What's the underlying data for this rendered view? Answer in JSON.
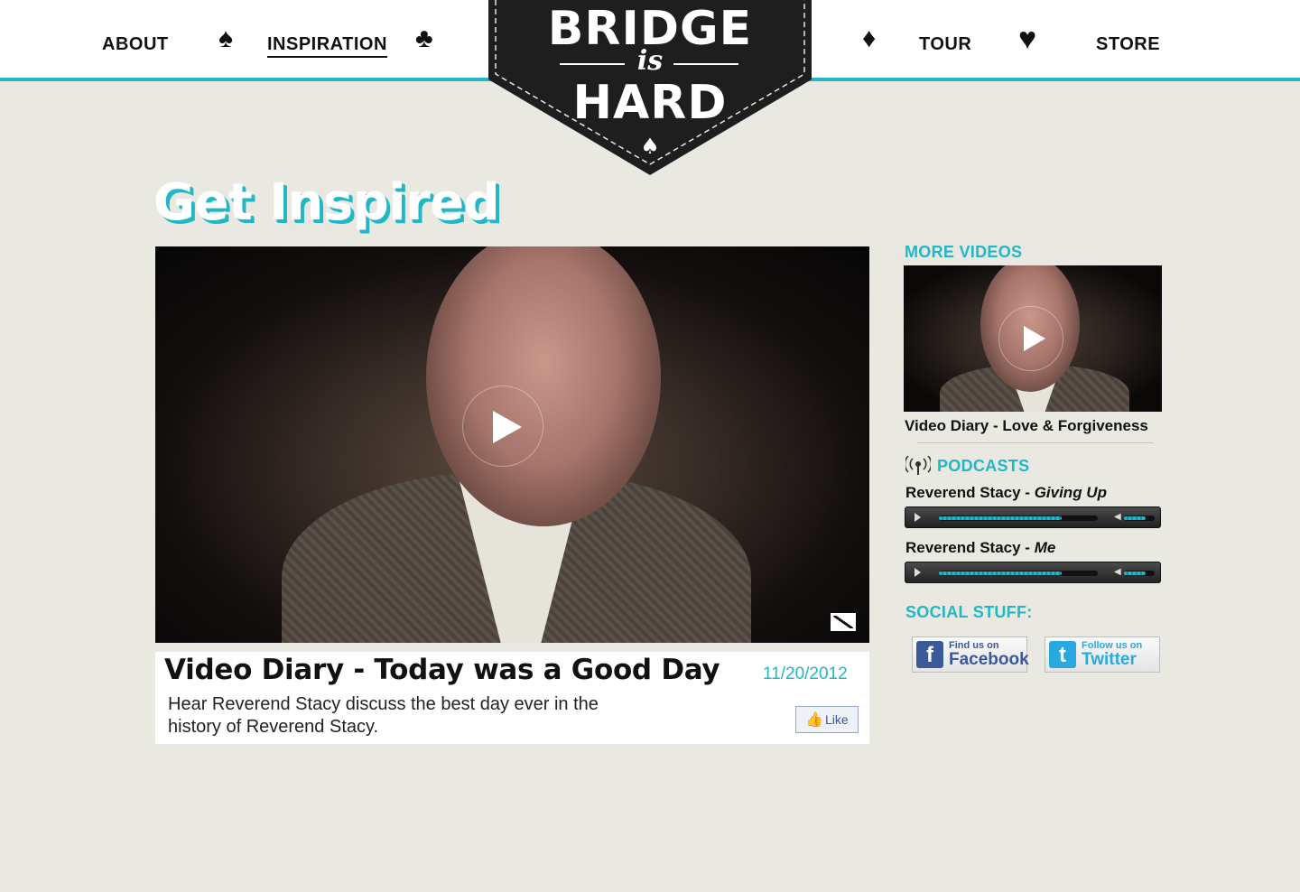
{
  "nav": {
    "left": [
      {
        "label": "ABOUT"
      },
      {
        "label": "INSPIRATION"
      }
    ],
    "right": [
      {
        "label": "TOUR"
      },
      {
        "label": "STORE"
      }
    ],
    "suits": {
      "spade": "♠",
      "club": "♣",
      "diamond": "♦",
      "heart": "♥",
      "logo_spade": "♠"
    }
  },
  "logo": {
    "line1": "BRIDGE",
    "line2": "is",
    "line3": "HARD"
  },
  "page_title": "Get Inspired",
  "main_video": {
    "title": "Video Diary - Today was a Good Day",
    "date": "11/20/2012",
    "description": "Hear Reverend Stacy discuss the best day ever in the history of Reverend Stacy.",
    "like_label": "Like"
  },
  "sidebar": {
    "more_videos_heading": "MORE VIDEOS",
    "more_videos": [
      {
        "title": "Video Diary - Love & Forgiveness"
      }
    ],
    "podcasts_heading": "PODCASTS",
    "podcasts": [
      {
        "speaker": "Reverend Stacy - ",
        "title": "Giving Up",
        "progress": 0.77,
        "volume": 0.7
      },
      {
        "speaker": "Reverend Stacy - ",
        "title": "Me",
        "progress": 0.77,
        "volume": 0.7
      }
    ],
    "social_heading": "SOCIAL STUFF:",
    "facebook": {
      "small": "Find us on",
      "big": "Facebook",
      "icon": "f"
    },
    "twitter": {
      "small": "Follow us on",
      "big": "Twitter",
      "icon": "t"
    }
  },
  "colors": {
    "accent": "#22b7c6",
    "background": "#e9e8e1",
    "logo": "#1e1e1e",
    "facebook": "#3b5998",
    "twitter": "#2aa9e0"
  }
}
